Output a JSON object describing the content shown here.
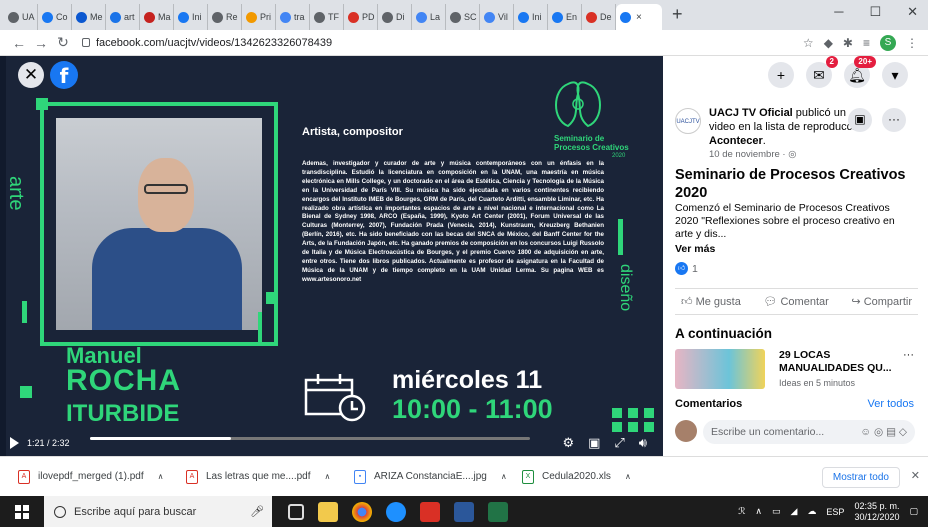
{
  "browser": {
    "tabs": [
      {
        "label": "UA",
        "color": "#5f6368"
      },
      {
        "label": "Co",
        "color": "#1877f2"
      },
      {
        "label": "Me",
        "color": "#0b57d0"
      },
      {
        "label": "art",
        "color": "#1a73e8"
      },
      {
        "label": "Ma",
        "color": "#c5221f"
      },
      {
        "label": "Ini",
        "color": "#1877f2"
      },
      {
        "label": "Re",
        "color": "#5f6368"
      },
      {
        "label": "Pri",
        "color": "#f29900"
      },
      {
        "label": "tra",
        "color": "#4285f4"
      },
      {
        "label": "TF",
        "color": "#5f6368"
      },
      {
        "label": "PD",
        "color": "#d93025"
      },
      {
        "label": "Di",
        "color": "#5f6368"
      },
      {
        "label": "La",
        "color": "#4285f4"
      },
      {
        "label": "SC",
        "color": "#5f6368"
      },
      {
        "label": "Vil",
        "color": "#4285f4"
      },
      {
        "label": "Ini",
        "color": "#1877f2"
      },
      {
        "label": "En",
        "color": "#1877f2"
      },
      {
        "label": "De",
        "color": "#d93025"
      }
    ],
    "active_tab_close": "×",
    "new_tab": "+",
    "url": "facebook.com/uacjtv/videos/1342623326078439",
    "profile_initial": "S"
  },
  "video": {
    "role": "Artista, compositor",
    "bio": "Ademas, investigador y curador de arte y música contemporáneos con un énfasis en la transdisciplina. Estudió la licenciatura en composición en la UNAM, una maestría en música electrónica en Mills College, y un doctorado en el área de Estética, Ciencia y Tecnología de la Música en la Universidad de París VIII. Su música ha sido ejecutada en varios continentes recibiendo encargos del Instituto IMEB de Bourges, GRM de París, del Cuarteto Arditti, ensamble Liminar, etc. Ha realizado obra artística en importantes espacios de arte a nivel nacional e internacional como La Bienal de Sydney 1998, ARCO (España, 1999), Kyoto Art Center (2001), Forum Universal de las Culturas (Monterrey, 2007), Fundación Prada (Venecia, 2014), Kunstraum, Kreuzberg Bethanien (Berlín, 2016), etc. Ha sido beneficiado con las becas del SNCA de México, del Banff Center for the Arts, de la Fundación Japón, etc. Ha ganado premios de composición en los concursos Luigi Russolo de Italia y de Música Electroacústica de Bourges, y el premio Cuervo 1800 de adquisición en arte, entre otros. Tiene dos libros publicados. Actualmente es profesor de asignatura en la Facultad de Música de la UNAM y de tiempo completo en la UAM Unidad Lerma. Su pagina WEB es www.artesonoro.net",
    "seminar_title_1": "Seminario de",
    "seminar_title_2": "Procesos Creativos",
    "seminar_year": "2020",
    "side_left": "arte",
    "side_right": "diseño",
    "name_first": "Manuel",
    "name_middle": "ROCHA",
    "name_last": "ITURBIDE",
    "day": "miércoles 11",
    "time": "10:00 - 11:00",
    "time_elapsed": "1:21 / 2:32",
    "progress": 0.32
  },
  "panel": {
    "page_name": "UACJ TV Oficial",
    "posted_text": " publicó un video en la lista de reproducción ",
    "playlist": "Acontecer",
    "date": "10 de noviembre · ",
    "avatar_text": "UACJTV",
    "messenger_badge": "2",
    "notif_badge": "20+",
    "title": "Seminario de Procesos Creativos 2020",
    "description": "Comenzó el Seminario de Procesos Creativos 2020 \"Reflexiones sobre el proceso creativo en arte y dis...",
    "see_more": "Ver más",
    "reaction_count": "1",
    "like": "Me gusta",
    "comment": "Comentar",
    "share": "Compartir",
    "next_heading": "A continuación",
    "next_title": "29 LOCAS MANUALIDADES QU...",
    "next_sub": "Ideas en 5 minutos",
    "comments_heading": "Comentarios",
    "see_all": "Ver todos",
    "comment_placeholder": "Escribe un comentario..."
  },
  "downloads": {
    "items": [
      {
        "name": "ilovepdf_merged (1).pdf",
        "type": "pdf"
      },
      {
        "name": "Las letras que me....pdf",
        "type": "pdf"
      },
      {
        "name": "ARIZA ConstanciaE....jpg",
        "type": "img"
      },
      {
        "name": "Cedula2020.xls",
        "type": "xls"
      }
    ],
    "show_all": "Mostrar todo"
  },
  "taskbar": {
    "search_placeholder": "Escribe aquí para buscar",
    "lang": "ESP",
    "time": "02:35 p. m.",
    "date": "30/12/2020"
  }
}
